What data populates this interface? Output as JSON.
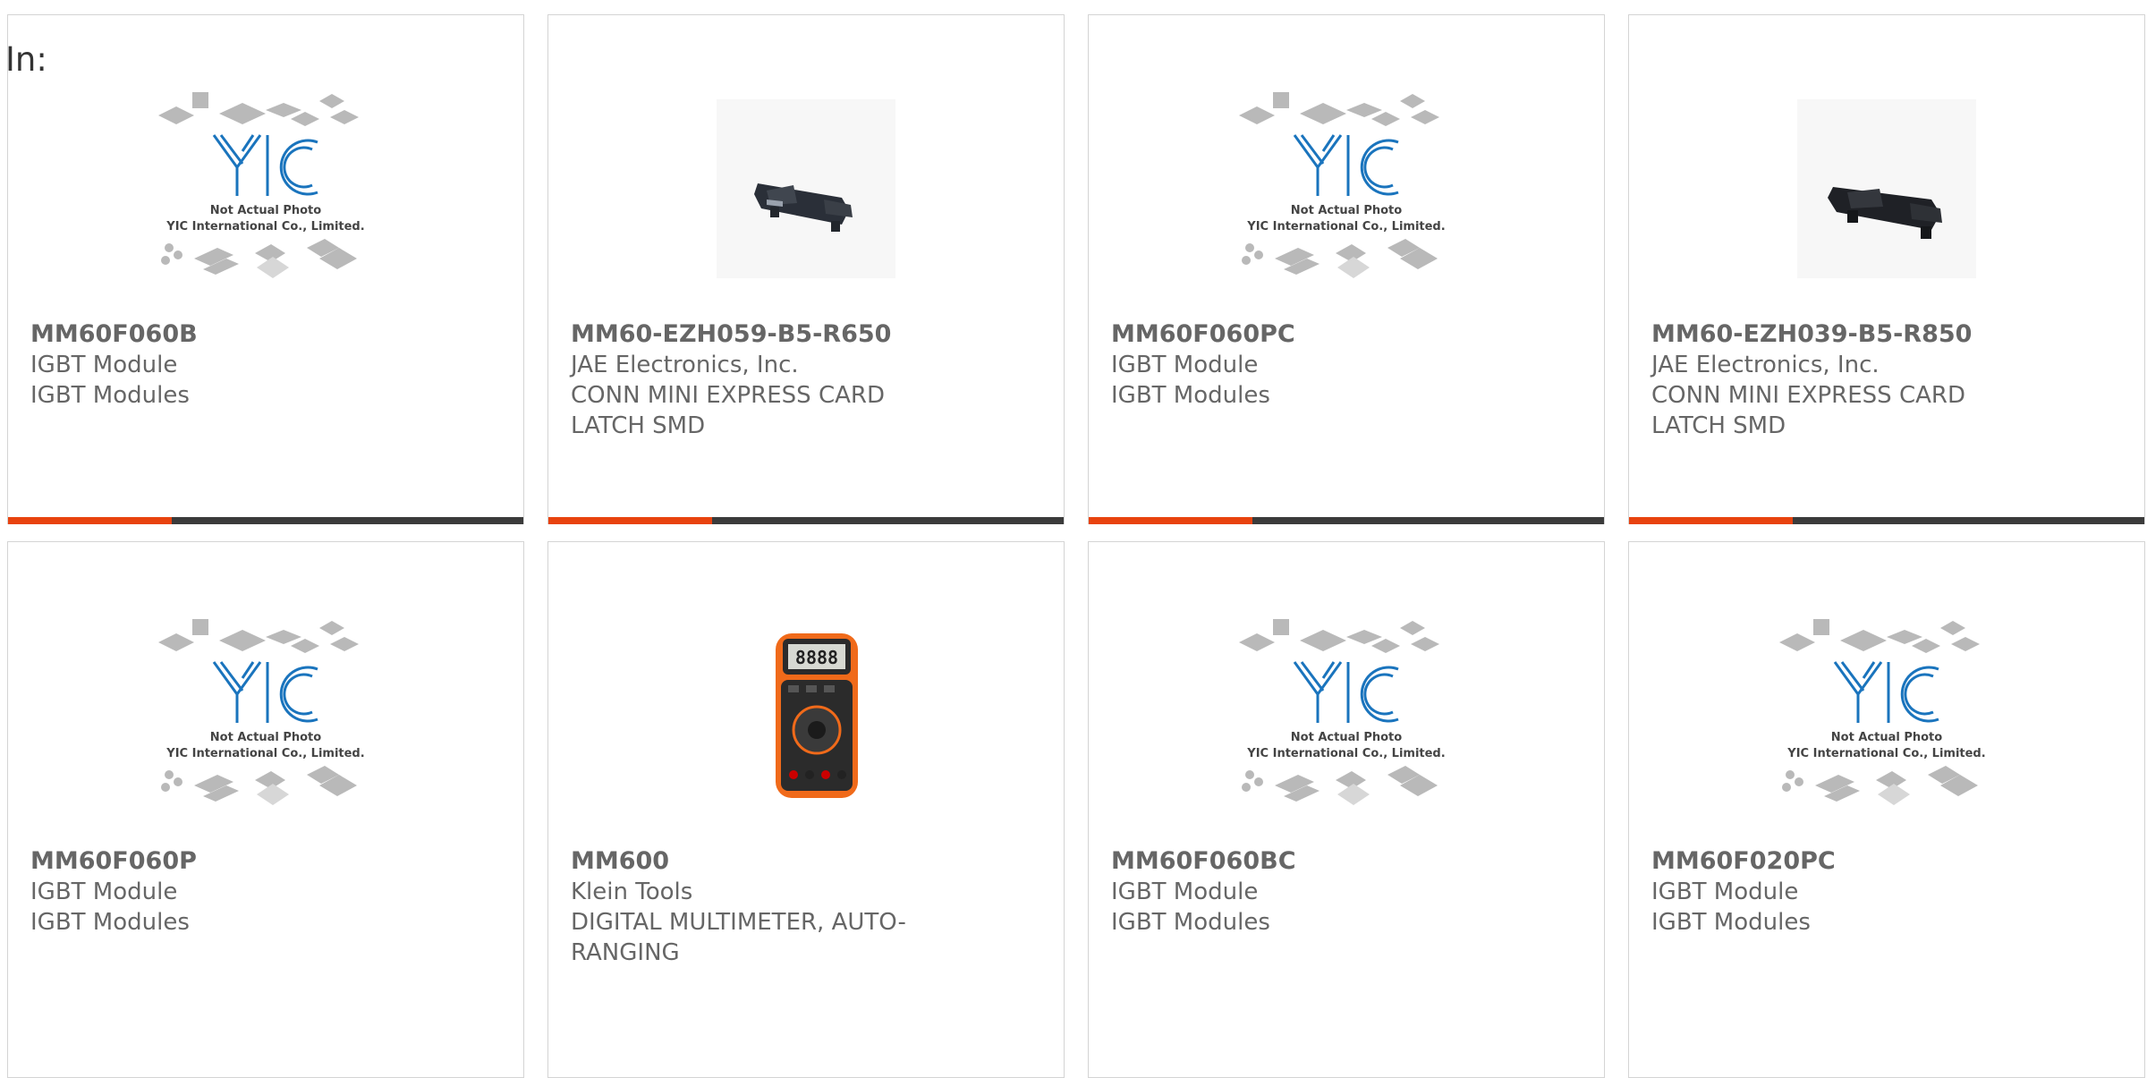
{
  "page": {
    "in_label": "In:"
  },
  "placeholder": {
    "line1": "Not Actual Photo",
    "line2": "YIC International Co., Limited.",
    "logo": "YIC"
  },
  "colors": {
    "accent": "#e8430f",
    "bar": "#3b3b3b",
    "logo_blue": "#1a74bd"
  },
  "products": [
    {
      "part": "MM60F060B",
      "manufacturer": "IGBT Module",
      "description": "IGBT Modules",
      "image": "placeholder-logo"
    },
    {
      "part": "MM60-EZH059-B5-R650",
      "manufacturer": "JAE Electronics, Inc.",
      "description": "CONN MINI EXPRESS CARD LATCH SMD",
      "image": "connector-photo"
    },
    {
      "part": "MM60F060PC",
      "manufacturer": "IGBT Module",
      "description": "IGBT Modules",
      "image": "placeholder-logo"
    },
    {
      "part": "MM60-EZH039-B5-R850",
      "manufacturer": "JAE Electronics, Inc.",
      "description": "CONN MINI EXPRESS CARD LATCH SMD",
      "image": "connector-photo"
    },
    {
      "part": "MM60F060P",
      "manufacturer": "IGBT Module",
      "description": "IGBT Modules",
      "image": "placeholder-logo"
    },
    {
      "part": "MM600",
      "manufacturer": "Klein Tools",
      "description": "DIGITAL MULTIMETER, AUTO-RANGING",
      "image": "multimeter-photo"
    },
    {
      "part": "MM60F060BC",
      "manufacturer": "IGBT Module",
      "description": "IGBT Modules",
      "image": "placeholder-logo"
    },
    {
      "part": "MM60F020PC",
      "manufacturer": "IGBT Module",
      "description": "IGBT Modules",
      "image": "placeholder-logo"
    }
  ]
}
